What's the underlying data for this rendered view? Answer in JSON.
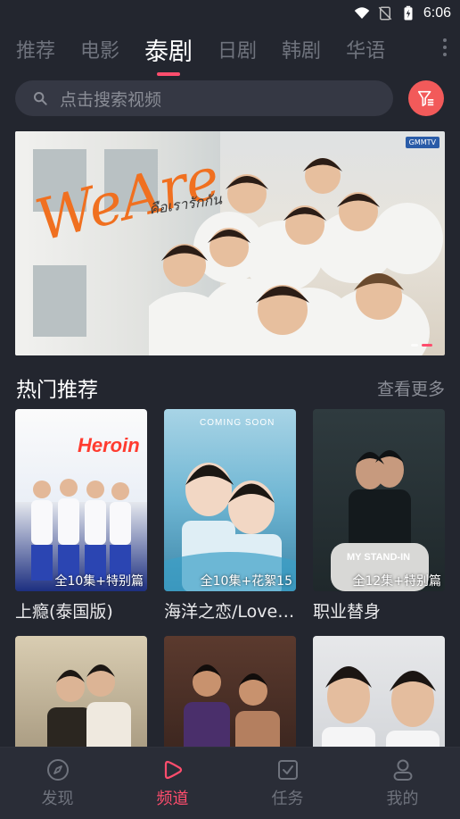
{
  "status_bar": {
    "time": "6:06"
  },
  "tabs": [
    {
      "label": "推荐",
      "active": false
    },
    {
      "label": "电影",
      "active": false
    },
    {
      "label": "泰剧",
      "active": true
    },
    {
      "label": "日剧",
      "active": false
    },
    {
      "label": "韩剧",
      "active": false
    },
    {
      "label": "华语",
      "active": false
    }
  ],
  "tabs_more_icon": "vertical-ellipsis-icon",
  "search": {
    "placeholder": "点击搜索视频",
    "icon": "search-icon"
  },
  "filter_button": {
    "icon": "filter-icon",
    "color": "#f25a5a"
  },
  "banner": {
    "title": "WeAre",
    "subtitle": "คือเรารักกัน",
    "logo": "GMMTV",
    "slide_count": 2,
    "active_slide": 2
  },
  "hot_section": {
    "title": "热门推荐",
    "more_label": "查看更多"
  },
  "cards": [
    {
      "title": "上瘾(泰国版)",
      "badge": "全10集+特别篇",
      "poster_text": "Heroin"
    },
    {
      "title": "海洋之恋/Love ...",
      "badge": "全10集+花絮15",
      "poster_text": "COMING SOON"
    },
    {
      "title": "职业替身",
      "badge": "全12集+特别篇",
      "poster_text": "MY STAND-IN"
    },
    {
      "title": "",
      "badge": "",
      "poster_text": ""
    },
    {
      "title": "",
      "badge": "",
      "poster_text": ""
    },
    {
      "title": "",
      "badge": "",
      "poster_text": ""
    }
  ],
  "bottom_nav": [
    {
      "label": "发现",
      "icon": "compass-icon",
      "active": false
    },
    {
      "label": "频道",
      "icon": "play-icon",
      "active": true
    },
    {
      "label": "任务",
      "icon": "task-icon",
      "active": false
    },
    {
      "label": "我的",
      "icon": "user-icon",
      "active": false
    }
  ],
  "colors": {
    "accent": "#ff4d6d",
    "background": "#23262f",
    "nav_bg": "#2a2d37"
  }
}
